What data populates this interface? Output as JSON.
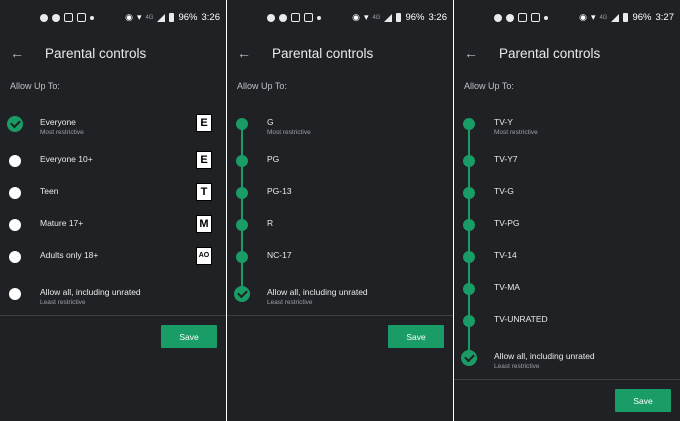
{
  "status": {
    "battery": "96%",
    "network": "4G"
  },
  "screens": [
    {
      "time": "3:26",
      "title": "Parental controls",
      "allow_label": "Allow Up To:",
      "options": [
        {
          "label": "Everyone",
          "sub": "Most restrictive",
          "badge": "E",
          "badge_icon": "esrb-e-icon",
          "selected": true
        },
        {
          "label": "Everyone 10+",
          "sub": "",
          "badge": "E",
          "badge_icon": "esrb-e10-icon",
          "selected": false
        },
        {
          "label": "Teen",
          "sub": "",
          "badge": "T",
          "badge_icon": "esrb-t-icon",
          "selected": false
        },
        {
          "label": "Mature 17+",
          "sub": "",
          "badge": "M",
          "badge_icon": "esrb-m-icon",
          "selected": false
        },
        {
          "label": "Adults only 18+",
          "sub": "",
          "badge": "AO",
          "badge_icon": "esrb-ao-icon",
          "selected": false
        },
        {
          "label": "Allow all, including unrated",
          "sub": "Least restrictive",
          "selected": false
        }
      ],
      "save": "Save"
    },
    {
      "time": "3:26",
      "title": "Parental controls",
      "allow_label": "Allow Up To:",
      "options": [
        {
          "label": "G",
          "sub": "Most restrictive"
        },
        {
          "label": "PG",
          "sub": ""
        },
        {
          "label": "PG-13",
          "sub": ""
        },
        {
          "label": "R",
          "sub": ""
        },
        {
          "label": "NC-17",
          "sub": ""
        },
        {
          "label": "Allow all, including unrated",
          "sub": "Least restrictive",
          "selected": true
        }
      ],
      "save": "Save"
    },
    {
      "time": "3:27",
      "title": "Parental controls",
      "allow_label": "Allow Up To:",
      "options": [
        {
          "label": "TV-Y",
          "sub": "Most restrictive"
        },
        {
          "label": "TV-Y7",
          "sub": ""
        },
        {
          "label": "TV-G",
          "sub": ""
        },
        {
          "label": "TV-PG",
          "sub": ""
        },
        {
          "label": "TV-14",
          "sub": ""
        },
        {
          "label": "TV-MA",
          "sub": ""
        },
        {
          "label": "TV-UNRATED",
          "sub": ""
        },
        {
          "label": "Allow all, including unrated",
          "sub": "Least restrictive",
          "selected": true
        }
      ],
      "save": "Save"
    }
  ],
  "colors": {
    "accent": "#1a9c66",
    "background": "#202124",
    "text": "#e8eaed"
  }
}
